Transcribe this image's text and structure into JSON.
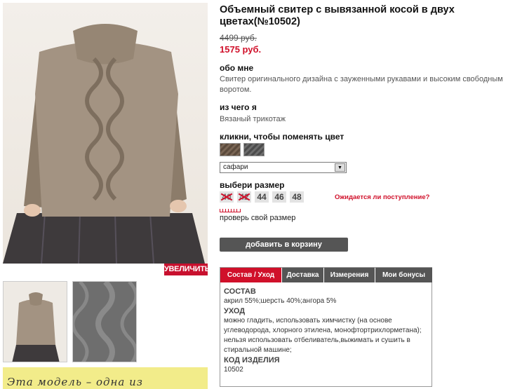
{
  "product": {
    "title": "Объемный свитер с вывязанной косой в двух цветах(№10502)",
    "old_price": "4499 руб.",
    "new_price": "1575 руб."
  },
  "gallery": {
    "zoom_label": "УВЕЛИЧИТЬ",
    "promo_text": "Эта модель – одна из"
  },
  "about": {
    "heading": "обо мне",
    "text": "Свитер оригинального дизайна с зауженными рукавами и высоким свободным воротом."
  },
  "material": {
    "heading": "из чего я",
    "text": "Вязаный трикотаж"
  },
  "color": {
    "heading": "кликни, чтобы поменять цвет",
    "selected": "сафари",
    "swatches": [
      "#6b5948",
      "#5c5c5c"
    ]
  },
  "size": {
    "heading": "выбери размер",
    "options": [
      {
        "label": "40",
        "available": false
      },
      {
        "label": "42",
        "available": false
      },
      {
        "label": "44",
        "available": true
      },
      {
        "label": "46",
        "available": true
      },
      {
        "label": "48",
        "available": true
      }
    ],
    "wait_link": "Ожидается ли поступление?",
    "check_size": "проверь свой размер"
  },
  "cart": {
    "button_label": "добавить в корзину"
  },
  "tabs": {
    "items": [
      "Состав / Уход",
      "Доставка",
      "Измерения",
      "Мои бонусы"
    ],
    "active": 0
  },
  "details": {
    "composition_heading": "СОСТАВ",
    "composition": "акрил 55%;шерсть 40%;ангора 5%",
    "care_heading": "УХОД",
    "care": "можно гладить, использовать химчистку (на основе углеводорода, хлорного этилена, монофтортрихлорметана); нельзя использовать отбеливатель,выжимать и сушить в стиральной машине;",
    "code_heading": "КОД ИЗДЕЛИЯ",
    "code": "10502"
  },
  "colors": {
    "accent": "#d0102a",
    "dark_button": "#555555",
    "sweater": "#9a8a78"
  }
}
